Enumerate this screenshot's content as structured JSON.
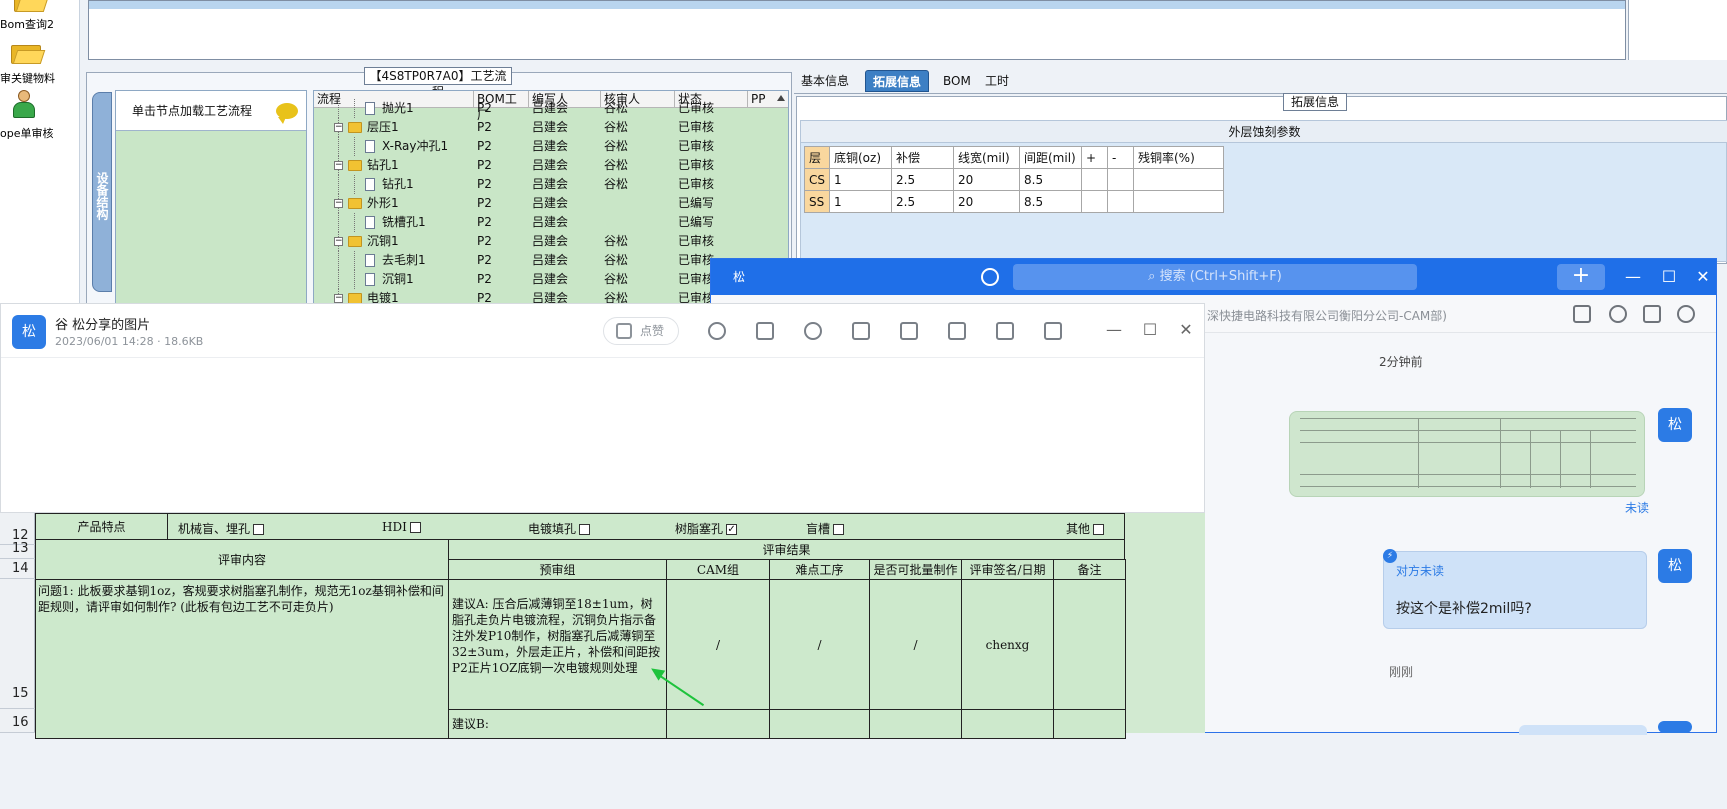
{
  "launcher": {
    "items": [
      {
        "label": "Bom查询2"
      },
      {
        "label": "审关键物料"
      },
      {
        "label": "ope单审核"
      }
    ]
  },
  "process": {
    "title": "【4S8TP0R7A0】工艺流程",
    "side_tab": "设备结构",
    "hint": "单击节点加载工艺流程",
    "columns": [
      "流程",
      "BOM工厂",
      "编写人",
      "核审人",
      "状态",
      "PP"
    ],
    "rows": [
      {
        "name": "抛光1",
        "factory": "P2",
        "writer": "吕建会",
        "reviewer": "谷松",
        "status": "已审核",
        "kind": "doc",
        "level": 2
      },
      {
        "name": "层压1",
        "factory": "P2",
        "writer": "吕建会",
        "reviewer": "谷松",
        "status": "已审核",
        "kind": "folder",
        "level": 1
      },
      {
        "name": "X-Ray冲孔1",
        "factory": "P2",
        "writer": "吕建会",
        "reviewer": "谷松",
        "status": "已审核",
        "kind": "doc",
        "level": 2
      },
      {
        "name": "钻孔1",
        "factory": "P2",
        "writer": "吕建会",
        "reviewer": "谷松",
        "status": "已审核",
        "kind": "folder",
        "level": 1
      },
      {
        "name": "钻孔1",
        "factory": "P2",
        "writer": "吕建会",
        "reviewer": "谷松",
        "status": "已审核",
        "kind": "doc",
        "level": 2
      },
      {
        "name": "外形1",
        "factory": "P2",
        "writer": "吕建会",
        "reviewer": "",
        "status": "已编写",
        "kind": "folder",
        "level": 1
      },
      {
        "name": "铣槽孔1",
        "factory": "P2",
        "writer": "吕建会",
        "reviewer": "",
        "status": "已编写",
        "kind": "doc",
        "level": 2
      },
      {
        "name": "沉铜1",
        "factory": "P2",
        "writer": "吕建会",
        "reviewer": "谷松",
        "status": "已审核",
        "kind": "folder",
        "level": 1
      },
      {
        "name": "去毛刺1",
        "factory": "P2",
        "writer": "吕建会",
        "reviewer": "谷松",
        "status": "已审核",
        "kind": "doc",
        "level": 2
      },
      {
        "name": "沉铜1",
        "factory": "P2",
        "writer": "吕建会",
        "reviewer": "谷松",
        "status": "已审核",
        "kind": "doc",
        "level": 2
      },
      {
        "name": "电镀1",
        "factory": "P2",
        "writer": "吕建会",
        "reviewer": "谷松",
        "status": "已审核",
        "kind": "folder",
        "level": 1
      }
    ]
  },
  "right_tabs": {
    "tabs": [
      "基本信息",
      "拓展信息",
      "BOM",
      "工时"
    ],
    "active": 1
  },
  "ext": {
    "label": "拓展信息",
    "title": "外层蚀刻参数",
    "columns": [
      "层",
      "底铜(oz)",
      "补偿",
      "线宽(mil)",
      "间距(mil)",
      "+",
      "-",
      "残铜率(%)"
    ],
    "rows": [
      [
        "CS",
        "1",
        "2.5",
        "20",
        "8.5",
        "",
        "",
        ""
      ],
      [
        "SS",
        "1",
        "2.5",
        "20",
        "8.5",
        "",
        "",
        ""
      ]
    ]
  },
  "chat": {
    "avatar": "松",
    "search_placeholder": "搜索 (Ctrl+Shift+F)",
    "plus": "+",
    "company": "深快捷电路科技有限公司衡阳分公司-CAM部)",
    "time1": "2分钟前",
    "avatar_right": "松",
    "unread": "未读",
    "quote": "对方未读",
    "message": "按这个是补偿2mil吗?",
    "time2": "刚刚"
  },
  "viewer": {
    "avatar": "松",
    "title": "谷 松分享的图片",
    "meta": "2023/06/01 14:28 · 18.6KB",
    "like": "点赞"
  },
  "sheet": {
    "row_numbers": [
      "12",
      "13",
      "14",
      "15",
      "16"
    ],
    "features_label": "产品特点",
    "features": [
      {
        "label": "机械盲、埋孔",
        "checked": false
      },
      {
        "label": "HDI",
        "checked": false
      },
      {
        "label": "电镀填孔",
        "checked": false
      },
      {
        "label": "树脂塞孔",
        "checked": true
      },
      {
        "label": "盲槽",
        "checked": false
      },
      {
        "label": "其他",
        "checked": false
      }
    ],
    "review_content": "评审内容",
    "review_result": "评审结果",
    "result_columns": [
      "预审组",
      "CAM组",
      "难点工序",
      "是否可批量制作",
      "评审签名/日期",
      "备注"
    ],
    "question": "问题1: 此板要求基铜1oz，客规要求树脂塞孔制作，规范无1oz基铜补偿和间距规则，请评审如何制作? (此板有包边工艺不可走负片)",
    "suggestion_a": "建议A: 压合后减薄铜至18±1um，树脂孔走负片电镀流程，沉铜负片指示备注外发P10制作，树脂塞孔后减薄铜至32±3um，外层走正片，补偿和间距按P2正片1OZ底铜一次电镀规则处理",
    "cam": "/",
    "difficult": "/",
    "batch": "/",
    "signer": "chenxg",
    "note": "",
    "suggestion_b": "建议B:"
  }
}
